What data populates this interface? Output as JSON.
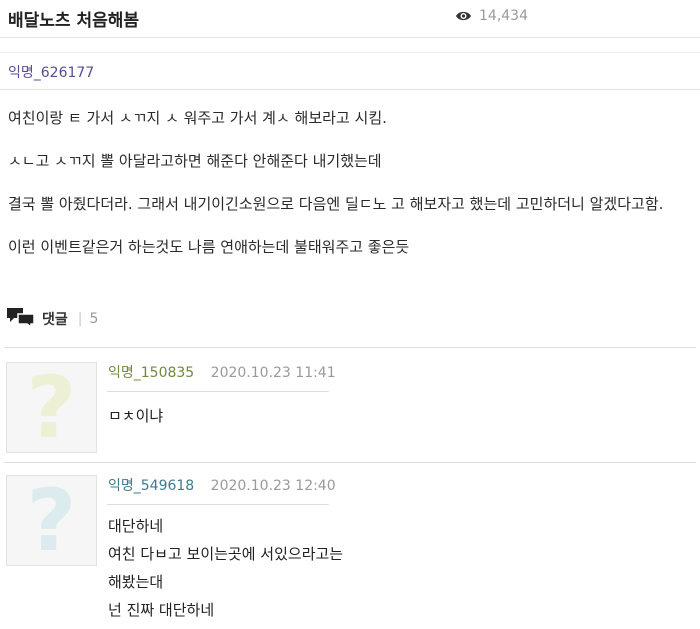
{
  "post": {
    "title": "배달노츠 처음해봄",
    "views": "14,434",
    "author": "익명_626177",
    "paragraphs": [
      "여친이랑 ㅌ 가서 ㅅㄲ지 ㅅ 워주고 가서 계ㅅ 해보라고 시킴.",
      "ㅅㄴ고 ㅅㄲ지 뽈 아달라고하면 해준다 안해준다 내기했는데",
      "결국 뽈 아줬다더라. 그래서 내기이긴소원으로 다음엔 딜ㄷ노 고 해보자고 했는데 고민하더니 알겠다고함.",
      "이런 이벤트같은거 하는것도 나름 연애하는데 불태워주고 좋은듯"
    ]
  },
  "comments_section": {
    "label": "댓글",
    "count": "5"
  },
  "comments": [
    {
      "user": "익명_150835",
      "date": "2020.10.23 11:41",
      "lines": [
        "ㅁㅊ이냐"
      ]
    },
    {
      "user": "익명_549618",
      "date": "2020.10.23 12:40",
      "lines": [
        "대단하네",
        "여친 다ㅂ고 보이는곳에 서있으라고는",
        "해봤는대",
        "넌 진짜 대단하네"
      ]
    }
  ],
  "colors": {
    "avatar_1": "#eef0d6",
    "avatar_2": "#dcebee"
  },
  "icons": [
    "eye-icon",
    "comment-bubbles-icon",
    "avatar-placeholder-icon"
  ]
}
